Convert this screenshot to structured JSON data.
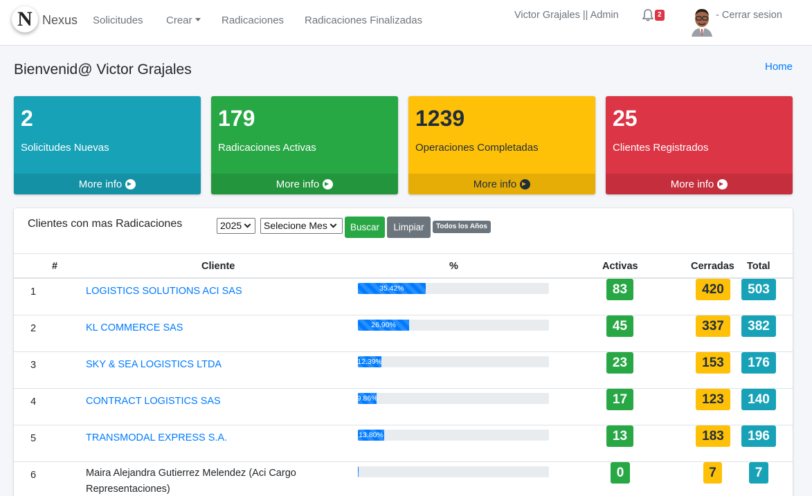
{
  "nav": {
    "brand_letter": "N",
    "brand": "Nexus",
    "links": [
      "Solicitudes",
      "Crear",
      "Radicaciones",
      "Radicaciones Finalizadas"
    ],
    "user": "Victor Grajales || Admin",
    "notifications": "2",
    "logout": "- Cerrar sesion"
  },
  "page": {
    "title": "Bienvenid@ Victor Grajales",
    "breadcrumb": "Home"
  },
  "boxes": [
    {
      "number": "2",
      "label": "Solicitudes Nuevas",
      "link": "More info",
      "color": "#17a2b8"
    },
    {
      "number": "179",
      "label": "Radicaciones Activas",
      "link": "More info",
      "color": "#28a745"
    },
    {
      "number": "1239",
      "label": "Operaciones Completadas",
      "link": "More info",
      "color": "#ffc107"
    },
    {
      "number": "25",
      "label": "Clientes Registrados",
      "link": "More info",
      "color": "#dc3545"
    }
  ],
  "table_card": {
    "title": "Clientes con mas Radicaciones",
    "year": "2025",
    "month_placeholder": "Selecione Mes",
    "search_button": "Buscar",
    "clear_button": "Limpiar",
    "all_years_tag": "Todos los Años",
    "headers": [
      "#",
      "Cliente",
      "%",
      "Activas",
      "Cerradas",
      "Total"
    ],
    "rows": [
      {
        "n": "1",
        "client": "LOGISTICS SOLUTIONS ACI SAS",
        "pct": 35.42,
        "pct_label": "35.42%",
        "activas": "83",
        "cerradas": "420",
        "total": "503"
      },
      {
        "n": "2",
        "client": "KL COMMERCE SAS",
        "pct": 26.9,
        "pct_label": "26.90%",
        "activas": "45",
        "cerradas": "337",
        "total": "382"
      },
      {
        "n": "3",
        "client": "SKY & SEA LOGISTICS LTDA",
        "pct": 12.39,
        "pct_label": "12.39%",
        "activas": "23",
        "cerradas": "153",
        "total": "176"
      },
      {
        "n": "4",
        "client": "CONTRACT LOGISTICS SAS",
        "pct": 9.86,
        "pct_label": "9.86%",
        "activas": "17",
        "cerradas": "123",
        "total": "140"
      },
      {
        "n": "5",
        "client": "TRANSMODAL EXPRESS S.A.",
        "pct": 13.8,
        "pct_label": "13.80%",
        "activas": "13",
        "cerradas": "183",
        "total": "196"
      },
      {
        "n": "6",
        "client": "Maira Alejandra Gutierrez Melendez (Aci Cargo Representaciones)",
        "pct": 0.49,
        "pct_label": "",
        "activas": "0",
        "cerradas": "7",
        "total": "7"
      }
    ]
  }
}
